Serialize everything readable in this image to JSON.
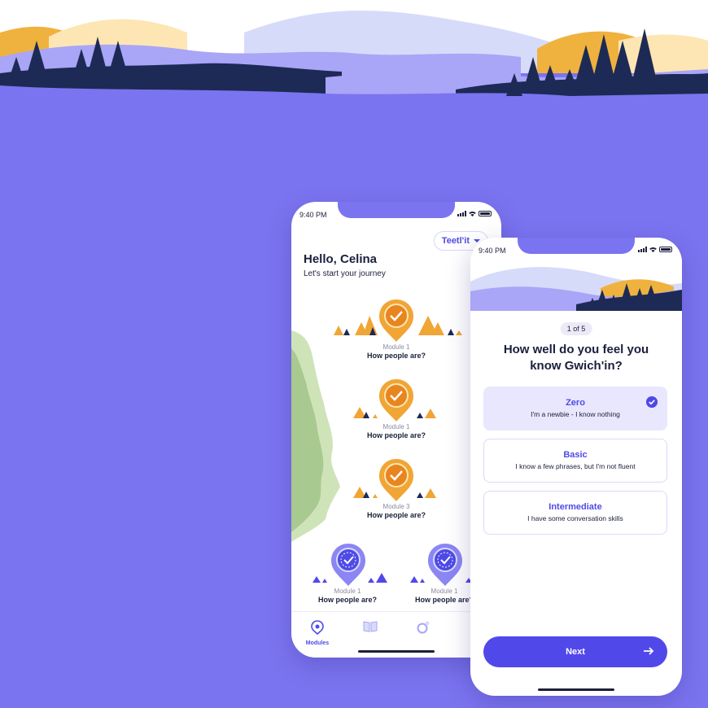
{
  "colors": {
    "background": "#7b74f0",
    "accent": "#4f4ae6",
    "pin_orange": "#f0a535",
    "dark_text": "#1b1f3b",
    "hill_dark": "#1d2a55",
    "hill_light": "#d7dbfa"
  },
  "phone_left": {
    "status_time": "9:40 PM",
    "language_label": "Teetl'it",
    "greeting": "Hello, Celina",
    "subtitle": "Let's start your journey",
    "modules": [
      {
        "number": "Module 1",
        "title": "How people are?",
        "state": "completed"
      },
      {
        "number": "Module 1",
        "title": "How people are?",
        "state": "completed"
      },
      {
        "number": "Module 3",
        "title": "How people are?",
        "state": "completed"
      },
      {
        "number": "Module 1",
        "title": "How people are?",
        "state": "in-progress"
      },
      {
        "number": "Module 1",
        "title": "How people are?",
        "state": "in-progress"
      }
    ],
    "tabs": [
      {
        "label": "Modules",
        "icon": "map-pin-icon",
        "active": true
      },
      {
        "label": "",
        "icon": "book-icon",
        "active": false
      },
      {
        "label": "",
        "icon": "gender-icon",
        "active": false
      }
    ]
  },
  "phone_right": {
    "status_time": "9:40 PM",
    "step_label": "1 of 5",
    "question": "How well do you feel you know Gwich'in?",
    "options": [
      {
        "title": "Zero",
        "description": "I'm a newbie - I know nothing",
        "selected": true
      },
      {
        "title": "Basic",
        "description": "I know a few phrases, but I'm not fluent",
        "selected": false
      },
      {
        "title": "Intermediate",
        "description": "I have some conversation skills",
        "selected": false
      }
    ],
    "next_label": "Next"
  }
}
